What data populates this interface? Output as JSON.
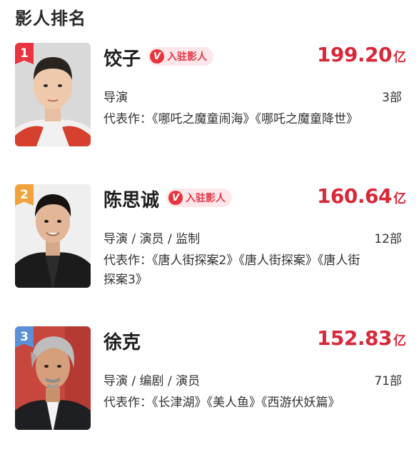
{
  "page": {
    "title": "影人排名"
  },
  "ranking": [
    {
      "rank": "1",
      "rank_color": "#e8343f",
      "name": "饺子",
      "badge": "入驻影人",
      "badge_icon": "V",
      "box_office": "199.20",
      "box_office_unit": "亿",
      "roles": "导演",
      "film_count": "3部",
      "works": "代表作：《哪吒之魔童闹海》《哪吒之魔童降世》"
    },
    {
      "rank": "2",
      "rank_color": "#f0a23b",
      "name": "陈思诚",
      "badge": "入驻影人",
      "badge_icon": "V",
      "box_office": "160.64",
      "box_office_unit": "亿",
      "roles": "导演 / 演员 / 监制",
      "film_count": "12部",
      "works": "代表作：《唐人街探案2》《唐人街探案》《唐人街探案3》"
    },
    {
      "rank": "3",
      "rank_color": "#5b8fd6",
      "name": "徐克",
      "box_office": "152.83",
      "box_office_unit": "亿",
      "roles": "导演 / 编剧 / 演员",
      "film_count": "71部",
      "works": "代表作：《长津湖》《美人鱼》《西游伏妖篇》"
    }
  ]
}
